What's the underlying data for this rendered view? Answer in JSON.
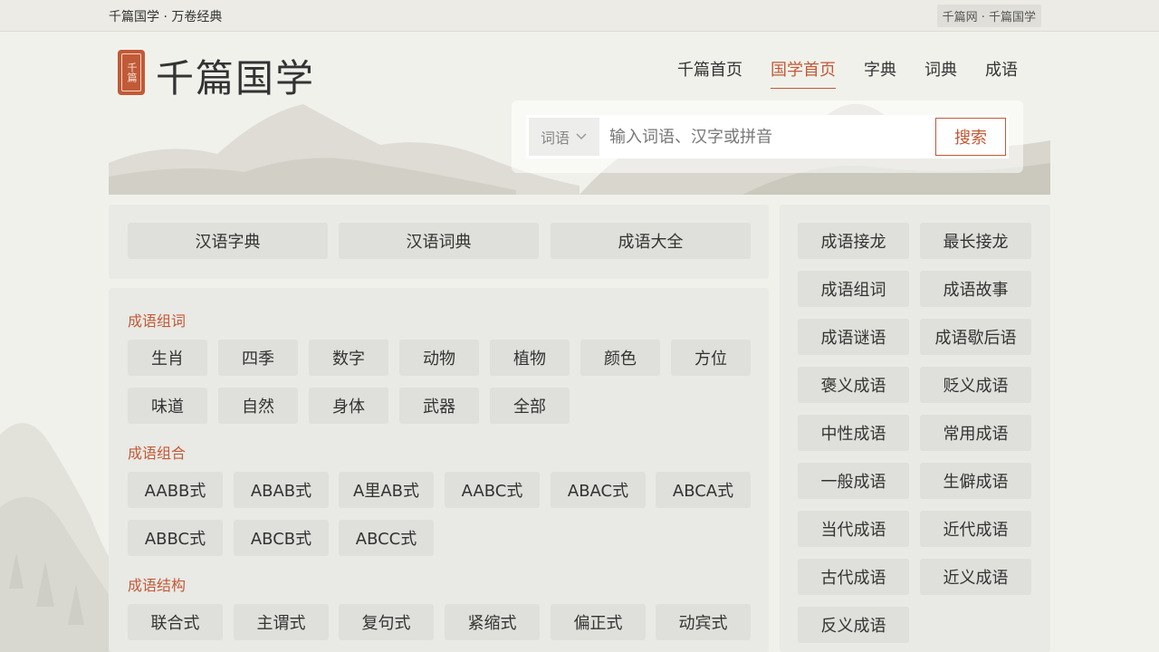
{
  "topbar": {
    "left_text": "千篇国学 · 万卷经典",
    "right_text": "千篇网 · 千篇国学"
  },
  "logo": {
    "seal_text": "千篇",
    "title": "千篇国学"
  },
  "nav": {
    "items": [
      {
        "label": "千篇首页"
      },
      {
        "label": "国学首页"
      },
      {
        "label": "字典"
      },
      {
        "label": "词典"
      },
      {
        "label": "成语"
      }
    ]
  },
  "search": {
    "select_value": "词语",
    "placeholder": "输入词语、汉字或拼音",
    "button_label": "搜索"
  },
  "quick_links": [
    {
      "label": "汉语字典"
    },
    {
      "label": "汉语词典"
    },
    {
      "label": "成语大全"
    }
  ],
  "sections": [
    {
      "title": "成语组词",
      "tags": [
        "生肖",
        "四季",
        "数字",
        "动物",
        "植物",
        "颜色",
        "方位",
        "味道",
        "自然",
        "身体",
        "武器",
        "全部"
      ]
    },
    {
      "title": "成语组合",
      "tags": [
        "AABB式",
        "ABAB式",
        "A里AB式",
        "AABC式",
        "ABAC式",
        "ABCA式",
        "ABBC式",
        "ABCB式",
        "ABCC式"
      ]
    },
    {
      "title": "成语结构",
      "tags": [
        "联合式",
        "主谓式",
        "复句式",
        "紧缩式",
        "偏正式",
        "动宾式"
      ]
    }
  ],
  "sidebar": {
    "items": [
      {
        "label": "成语接龙"
      },
      {
        "label": "最长接龙"
      },
      {
        "label": "成语组词"
      },
      {
        "label": "成语故事"
      },
      {
        "label": "成语谜语"
      },
      {
        "label": "成语歇后语"
      },
      {
        "label": "褒义成语"
      },
      {
        "label": "贬义成语"
      },
      {
        "label": "中性成语"
      },
      {
        "label": "常用成语"
      },
      {
        "label": "一般成语"
      },
      {
        "label": "生僻成语"
      },
      {
        "label": "当代成语"
      },
      {
        "label": "近代成语"
      },
      {
        "label": "古代成语"
      },
      {
        "label": "近义成语"
      },
      {
        "label": "反义成语"
      }
    ]
  },
  "colors": {
    "accent": "#c15a37",
    "background": "#f1f1ec",
    "panel": "#e9e9e5",
    "button": "#dfdfdb"
  }
}
